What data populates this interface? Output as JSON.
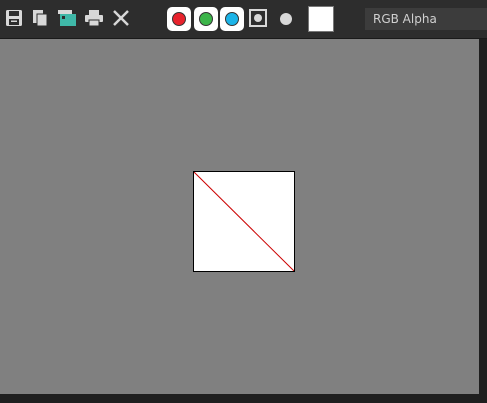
{
  "toolbar": {
    "tools": [
      {
        "icon": "save-icon"
      },
      {
        "icon": "copy-icon"
      },
      {
        "icon": "clone-icon"
      },
      {
        "icon": "print-icon"
      },
      {
        "icon": "close-icon"
      }
    ],
    "channels": [
      {
        "name": "red",
        "color": "#e8232d"
      },
      {
        "name": "green",
        "color": "#3cb54a"
      },
      {
        "name": "blue",
        "color": "#1cb4e8"
      }
    ],
    "alpha_icon": "alpha-channel-icon",
    "mono_icon": "monochrome-icon",
    "swatch_color": "#ffffff",
    "channel_select_value": "RGB Alpha"
  },
  "viewport": {
    "background": "#808080",
    "image": {
      "background": "#ffffff",
      "diagonal_color": "#cc0000"
    }
  }
}
